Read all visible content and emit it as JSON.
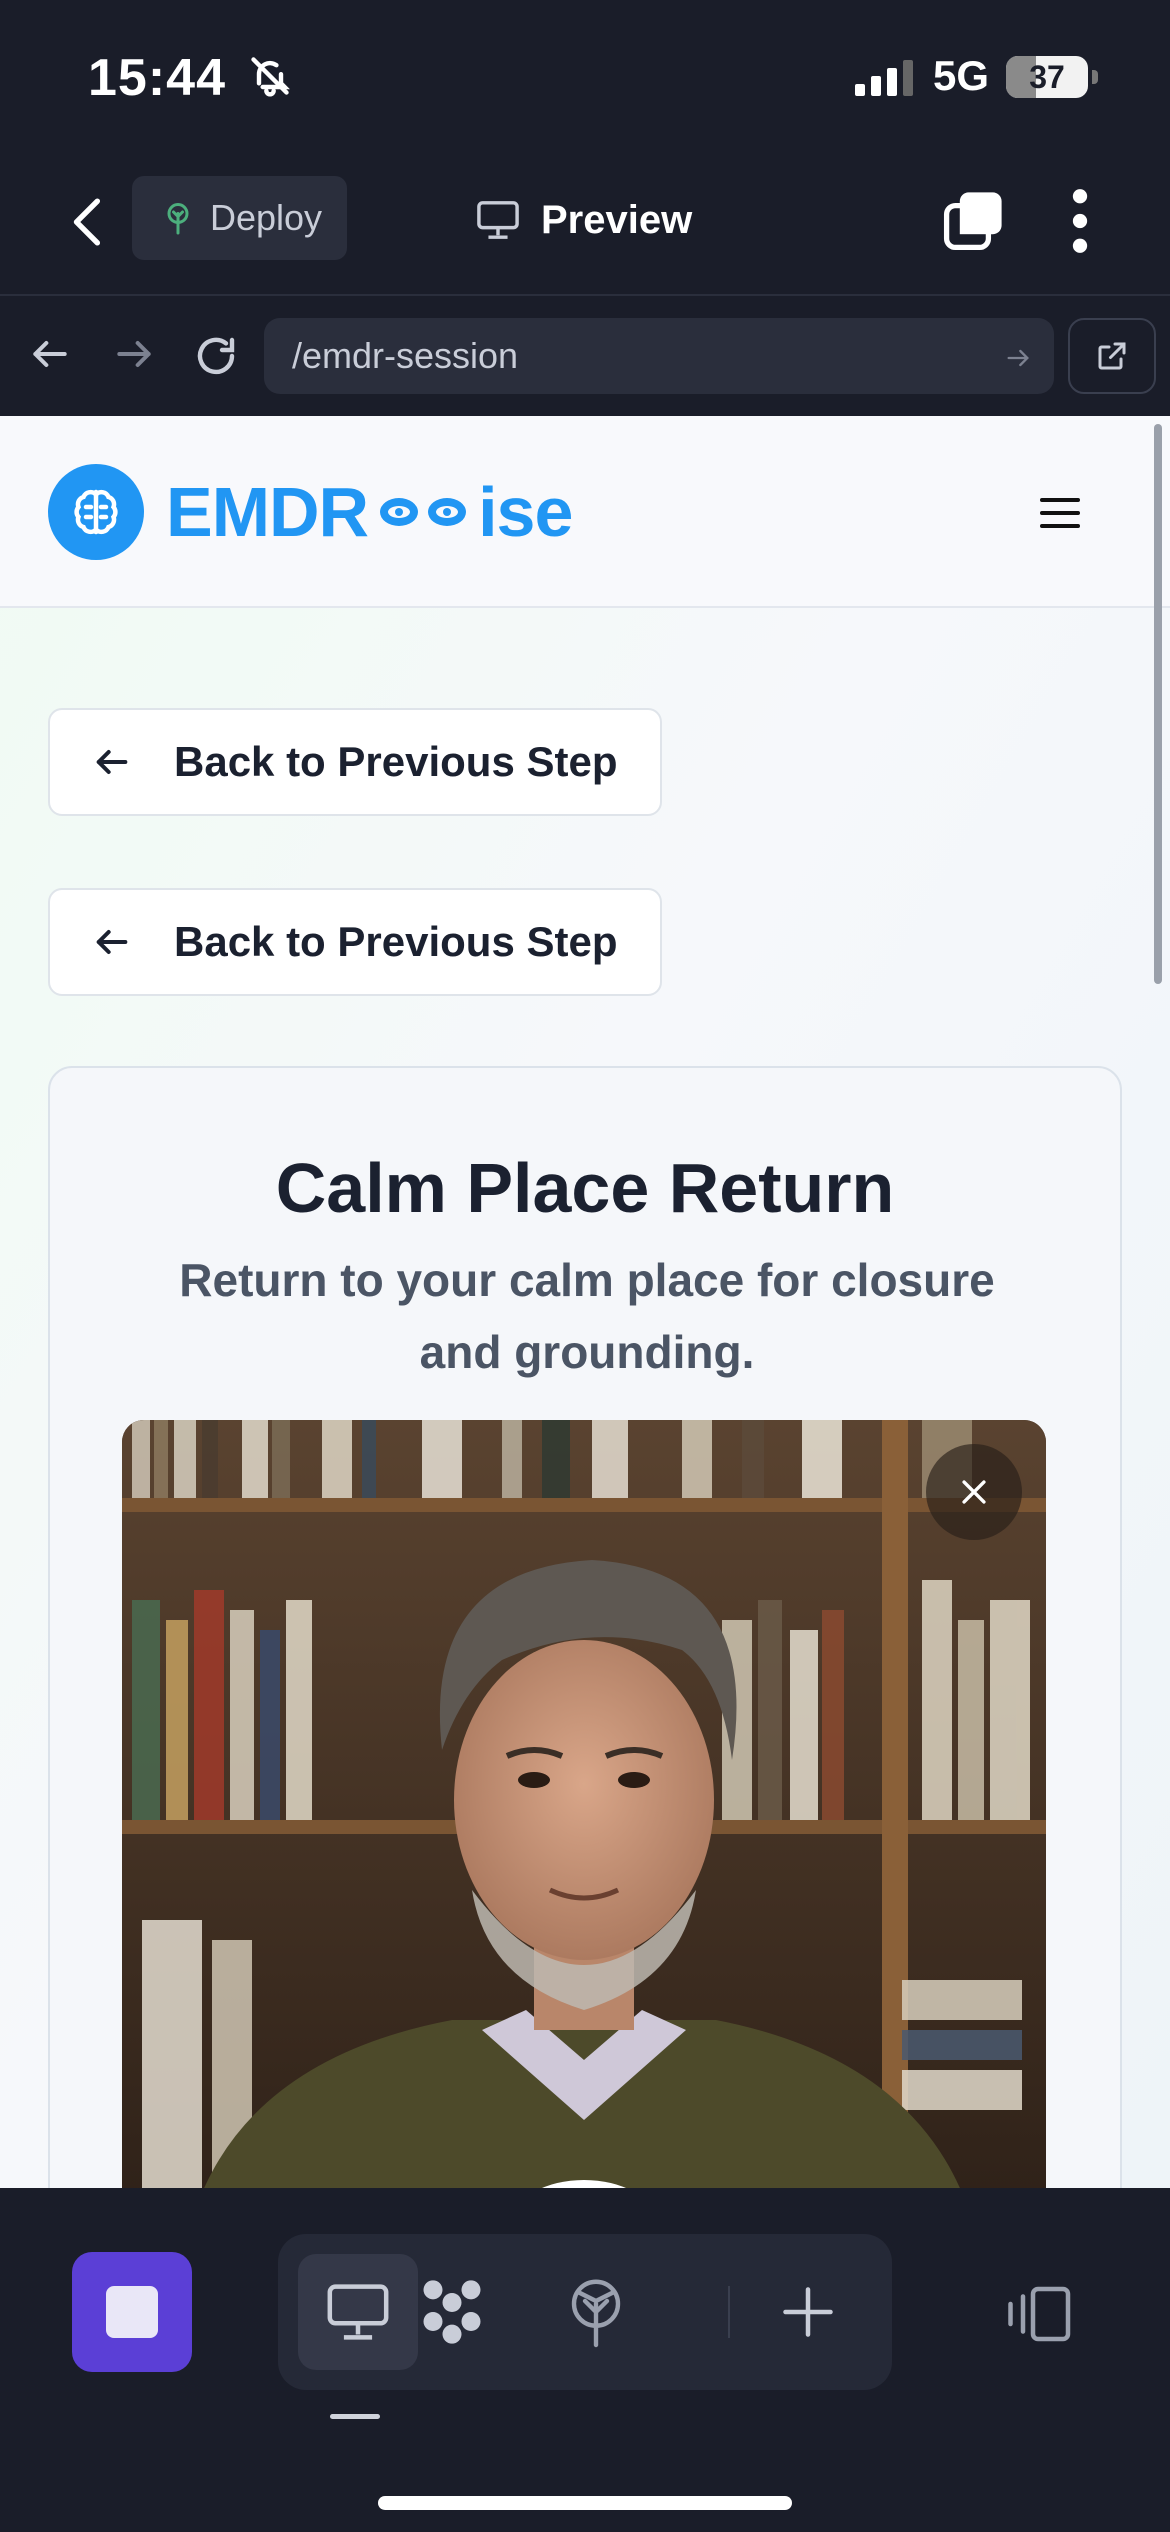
{
  "status_bar": {
    "time": "15:44",
    "network": "5G",
    "battery": "37",
    "battery_level": 0.37
  },
  "top_bar": {
    "deploy_label": "Deploy",
    "preview_label": "Preview"
  },
  "url_bar": {
    "url": "/emdr-session"
  },
  "site_header": {
    "logo_left": "EMDR",
    "logo_right": "ise"
  },
  "back_buttons": [
    {
      "label": "Back to Previous Step"
    },
    {
      "label": "Back to Previous Step"
    }
  ],
  "session_card": {
    "title": "Calm Place Return",
    "subtitle": "Return to your calm place for closure and grounding."
  },
  "colors": {
    "brand": "#2196f3",
    "accent": "#5b3fd6",
    "chrome": "#1a1d29"
  }
}
